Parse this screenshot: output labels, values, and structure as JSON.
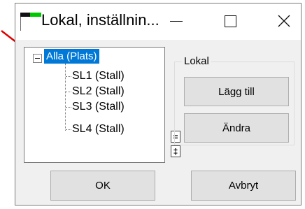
{
  "window": {
    "title": "Lokal, inställnin..."
  },
  "tree": {
    "root": "Alla (Plats)",
    "children": [
      "SL1 (Stall)",
      "SL2 (Stall)",
      "SL3 (Stall)",
      "SL4 (Stall)"
    ]
  },
  "group": {
    "title": "Lokal"
  },
  "buttons": {
    "add": "Lägg till",
    "edit": "Ändra",
    "ok": "OK",
    "cancel": "Avbryt",
    "collapse_symbol": "=",
    "expand_symbol": "‡"
  },
  "colors": {
    "selection": "#0078d7",
    "annotation_arrow": "#e00000",
    "icon_green": "#00c800"
  },
  "icons": [
    "application-icon",
    "minimize-icon",
    "maximize-icon",
    "close-icon",
    "collapse-icon",
    "annotation-arrow-icon"
  ]
}
